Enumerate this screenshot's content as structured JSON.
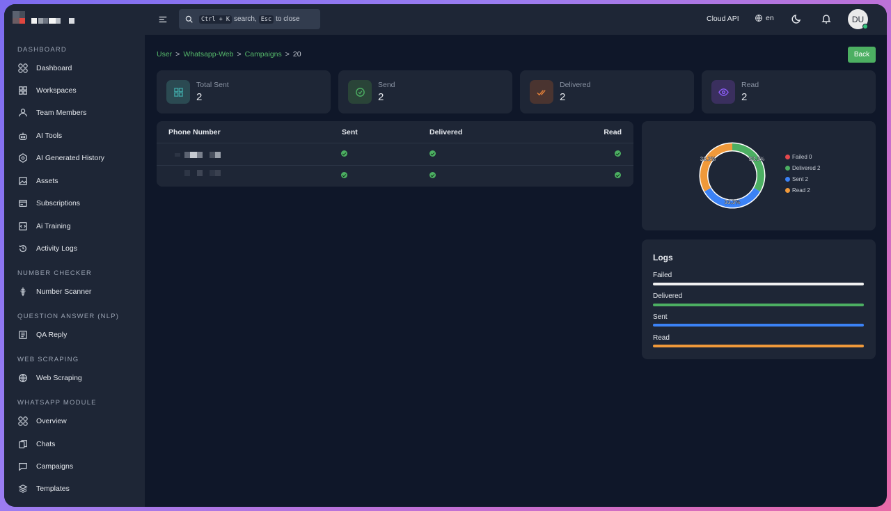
{
  "sidebar": {
    "sections": [
      {
        "title": "DASHBOARD"
      },
      {
        "title": "NUMBER CHECKER"
      },
      {
        "title": "QUESTION ANSWER (NLP)"
      },
      {
        "title": "WEB SCRAPING"
      },
      {
        "title": "WHATSAPP MODULE"
      }
    ],
    "items": [
      {
        "label": "Dashboard",
        "icon": "grid-circles-icon"
      },
      {
        "label": "Workspaces",
        "icon": "squares-icon"
      },
      {
        "label": "Team Members",
        "icon": "user-icon"
      },
      {
        "label": "AI Tools",
        "icon": "robot-icon"
      },
      {
        "label": "AI Generated History",
        "icon": "ai-history-icon"
      },
      {
        "label": "Assets",
        "icon": "image-icon"
      },
      {
        "label": "Subscriptions",
        "icon": "card-icon"
      },
      {
        "label": "Ai Training",
        "icon": "code-box-icon"
      },
      {
        "label": "Activity Logs",
        "icon": "history-icon"
      },
      {
        "label": "Number Scanner",
        "icon": "scanner-icon"
      },
      {
        "label": "QA Reply",
        "icon": "document-icon"
      },
      {
        "label": "Web Scraping",
        "icon": "globe-icon"
      },
      {
        "label": "Overview",
        "icon": "grid-circles-icon"
      },
      {
        "label": "Chats",
        "icon": "chat-copy-icon"
      },
      {
        "label": "Campaigns",
        "icon": "message-icon"
      },
      {
        "label": "Templates",
        "icon": "layers-icon"
      }
    ]
  },
  "topbar": {
    "search_prefix_key": "Ctrl + K",
    "search_mid": "search,",
    "search_esc_key": "Esc",
    "search_suffix": "to close",
    "cloud_api": "Cloud API",
    "language": "en",
    "avatar_initials": "DU"
  },
  "breadcrumb": {
    "items": [
      "User",
      "Whatsapp-Web",
      "Campaigns",
      "20"
    ],
    "separator": ">"
  },
  "back_label": "Back",
  "stats": [
    {
      "label": "Total Sent",
      "value": "2",
      "color": "#3ea0a0"
    },
    {
      "label": "Send",
      "value": "2",
      "color": "#4caf62"
    },
    {
      "label": "Delivered",
      "value": "2",
      "color": "#e8833a"
    },
    {
      "label": "Read",
      "value": "2",
      "color": "#8b5cf6"
    }
  ],
  "table": {
    "columns": [
      "Phone Number",
      "Sent",
      "Delivered",
      "Read"
    ],
    "rows": [
      {
        "sent": true,
        "delivered": true,
        "read": true
      },
      {
        "sent": true,
        "delivered": true,
        "read": true
      }
    ]
  },
  "chart_data": {
    "type": "pie",
    "categories": [
      "Failed",
      "Delivered",
      "Sent",
      "Read"
    ],
    "values": [
      0,
      2,
      2,
      2
    ],
    "percent_labels": [
      "33.3%",
      "33.3%",
      "33.3%"
    ],
    "legend": [
      "Failed 0",
      "Delivered 2",
      "Sent 2",
      "Read 2"
    ],
    "colors": [
      "#e5484d",
      "#4caf62",
      "#3b82f6",
      "#f0993a"
    ],
    "legend_position": "right"
  },
  "logs": {
    "title": "Logs",
    "items": [
      {
        "label": "Failed",
        "color": "#f1f1f1"
      },
      {
        "label": "Delivered",
        "color": "#4caf62"
      },
      {
        "label": "Sent",
        "color": "#3b82f6"
      },
      {
        "label": "Read",
        "color": "#f0993a"
      }
    ]
  }
}
